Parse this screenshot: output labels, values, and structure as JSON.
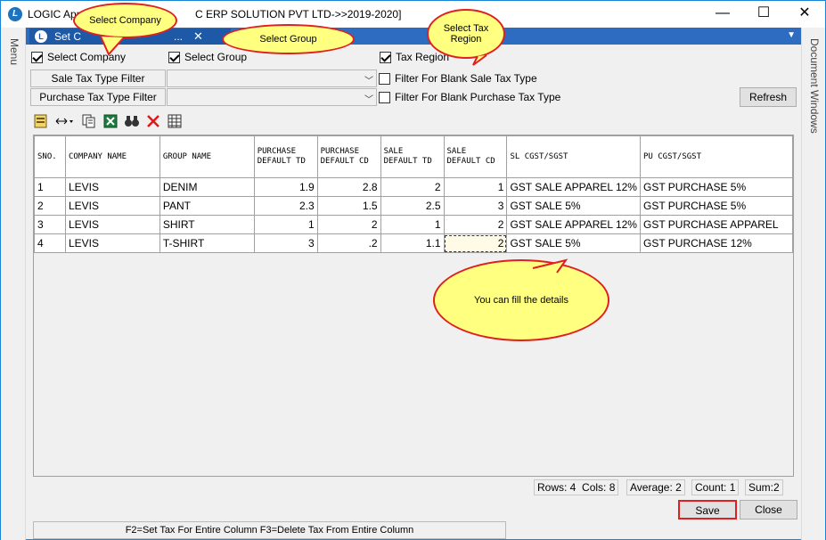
{
  "window": {
    "title_left": "LOGIC App",
    "title_right": "C ERP SOLUTION PVT LTD->>2019-2020]",
    "minimize": "—",
    "maximize": "☐",
    "close": "✕"
  },
  "sidebar": {
    "menu_label": "Menu",
    "document_windows_label": "Document Windows"
  },
  "tab": {
    "label": "Set C",
    "label_tail": "...",
    "close": "✕"
  },
  "checks": {
    "select_company": {
      "label": "Select Company",
      "checked": true
    },
    "select_group": {
      "label": "Select Group",
      "checked": true
    },
    "tax_region": {
      "label": "Tax Region",
      "checked": true
    }
  },
  "filters": {
    "sale_label": "Sale Tax Type Filter",
    "purchase_label": "Purchase Tax Type Filter",
    "blank_sale": "Filter For Blank Sale Tax Type",
    "blank_purchase": "Filter For Blank Purchase Tax Type"
  },
  "buttons": {
    "refresh": "Refresh",
    "save": "Save",
    "close": "Close"
  },
  "grid": {
    "headers": [
      "SNO.",
      "COMPANY NAME",
      "GROUP NAME",
      "PURCHASE DEFAULT TD",
      "PURCHASE DEFAULT CD",
      "SALE DEFAULT TD",
      "SALE DEFAULT CD",
      "SL CGST/SGST",
      "PU CGST/SGST"
    ],
    "rows": [
      [
        "1",
        "LEVIS",
        "DENIM",
        "1.9",
        "2.8",
        "2",
        "1",
        "GST SALE APPAREL 12%",
        "GST PURCHASE 5%"
      ],
      [
        "2",
        "LEVIS",
        "PANT",
        "2.3",
        "1.5",
        "2.5",
        "3",
        "GST SALE 5%",
        "GST PURCHASE 5%"
      ],
      [
        "3",
        "LEVIS",
        "SHIRT",
        "1",
        "2",
        "1",
        "2",
        "GST SALE APPAREL 12%",
        "GST PURCHASE APPAREL"
      ],
      [
        "4",
        "LEVIS",
        "T-SHIRT",
        "3",
        ".2",
        "1.1",
        "2",
        "GST SALE 5%",
        "GST PURCHASE 12%"
      ]
    ]
  },
  "status": {
    "rows": "Rows: 4",
    "cols": "Cols: 8",
    "average": "Average: 2",
    "count": "Count: 1",
    "sum": "Sum:2"
  },
  "footer": {
    "hint": "F2=Set Tax For Entire Column  F3=Delete Tax From Entire Column"
  },
  "callouts": {
    "select_company": "Select  Company",
    "select_group": "Select  Group",
    "select_tax_region": "Select  Tax\nRegion",
    "fill_details": "You  can  fill  the  details"
  },
  "colors": {
    "tab_bg": "#2d6cc0",
    "callout_fill": "#ffff80",
    "callout_border": "#e02020"
  }
}
